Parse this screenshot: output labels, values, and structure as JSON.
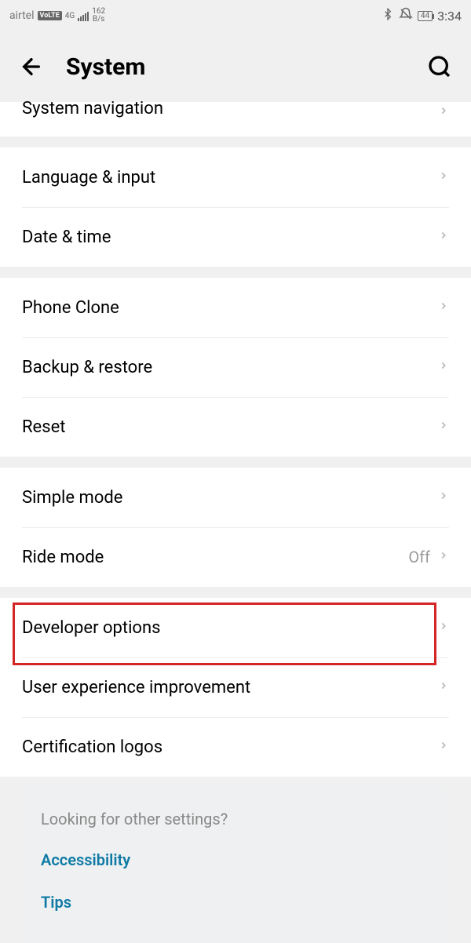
{
  "status": {
    "carrier": "airtel",
    "volte": "VoLTE",
    "network": "4G",
    "speed_top": "162",
    "speed_bottom": "B/s",
    "battery": "44",
    "time": "3:34"
  },
  "header": {
    "title": "System"
  },
  "groups": [
    {
      "rows": [
        {
          "key": "system-navigation",
          "label": "System navigation",
          "partial": true
        }
      ]
    },
    {
      "rows": [
        {
          "key": "language-input",
          "label": "Language & input"
        },
        {
          "key": "date-time",
          "label": "Date & time"
        }
      ]
    },
    {
      "rows": [
        {
          "key": "phone-clone",
          "label": "Phone Clone"
        },
        {
          "key": "backup-restore",
          "label": "Backup & restore"
        },
        {
          "key": "reset",
          "label": "Reset"
        }
      ]
    },
    {
      "rows": [
        {
          "key": "simple-mode",
          "label": "Simple mode"
        },
        {
          "key": "ride-mode",
          "label": "Ride mode",
          "value": "Off"
        }
      ]
    },
    {
      "rows": [
        {
          "key": "developer-options",
          "label": "Developer options"
        },
        {
          "key": "user-experience-improvement",
          "label": "User experience improvement"
        },
        {
          "key": "certification-logos",
          "label": "Certification logos"
        }
      ]
    }
  ],
  "footer": {
    "title": "Looking for other settings?",
    "links": [
      {
        "key": "accessibility",
        "label": "Accessibility"
      },
      {
        "key": "tips",
        "label": "Tips"
      }
    ]
  }
}
